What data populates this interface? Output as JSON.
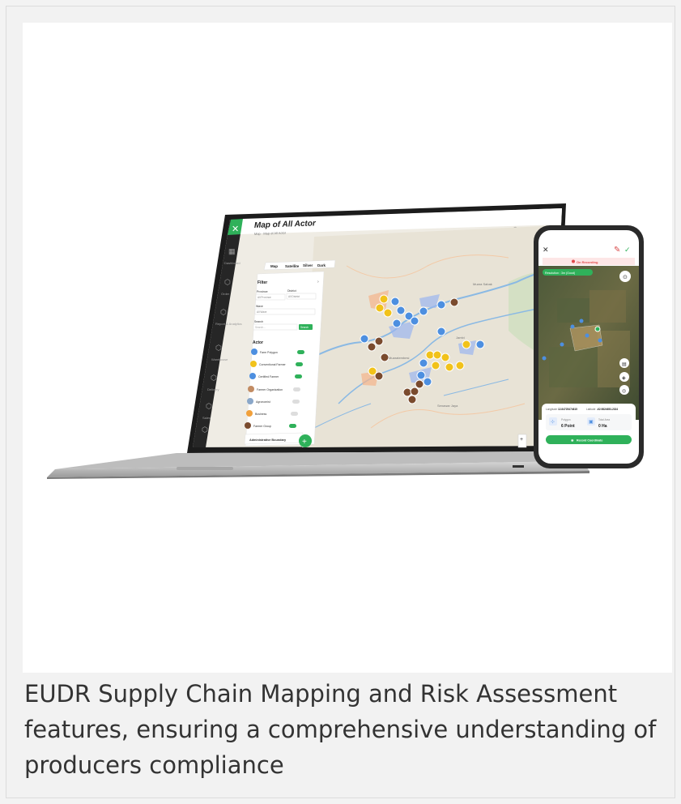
{
  "caption": "EUDR Supply Chain Mapping and Risk Assessment features, ensuring a comprehensive understanding of producers compliance",
  "laptop": {
    "page_title": "Map of All Actor",
    "breadcrumb": "Map · Map of All Actor",
    "sidebar": [
      "Dashboard",
      "Order",
      "Report & Analytics",
      "Warehouse",
      "Delivery",
      "Sales"
    ],
    "map_types": [
      "Map",
      "Satellite",
      "Silver",
      "Dark"
    ],
    "filter": {
      "title": "Filter",
      "province_label": "Province",
      "province_value": "All Province",
      "district_label": "District",
      "district_value": "All District",
      "wave_label": "Wave",
      "wave_value": "All Wave",
      "search_label": "Search",
      "search_placeholder": "Search...",
      "search_button": "Search"
    },
    "actor_title": "Actor",
    "actors": [
      "Farm Polygon",
      "Conventional Farmer",
      "Certified Farmer",
      "Farmer Organization",
      "Agronomist",
      "Business",
      "Farmer Group"
    ],
    "admin_boundary": "Administrative Boundary",
    "map_labels": [
      "Muara Sabak",
      "Muaratembesi",
      "Jambi",
      "Senawar Jaya"
    ]
  },
  "phone": {
    "status": "On Recording",
    "resolution": "Resolution : 3m (Good)",
    "longitude_label": "Longitude",
    "longitude_value": "12.84725474615",
    "latitude_label": "Latitude",
    "latitude_value": "-62.9824653-2324",
    "polygon_label": "Polygon",
    "polygon_value": "6 Point",
    "area_label": "Total Area",
    "area_value": "0 Ha",
    "record_button": "Record Coordinate"
  },
  "colors": {
    "brand_green": "#2fb15a",
    "sidebar_dark": "#222222",
    "marker_yellow": "#f1c21a",
    "marker_blue": "#4d8fe0",
    "marker_brown": "#7a4b2e"
  }
}
